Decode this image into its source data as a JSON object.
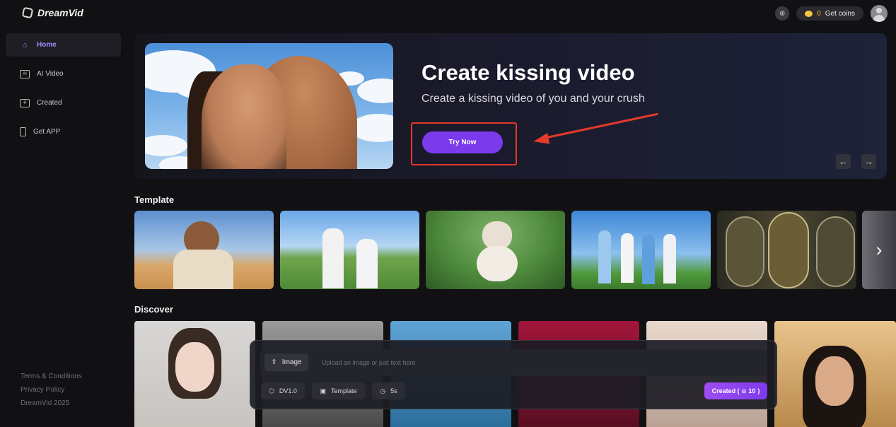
{
  "app": {
    "name": "DreamVid"
  },
  "header": {
    "coins": "0",
    "get_coins_label": "Get coins"
  },
  "sidebar": {
    "items": [
      {
        "label": "Home",
        "icon": "home-icon"
      },
      {
        "label": "AI Video",
        "icon": "ai-video-icon",
        "icon_text": "AI"
      },
      {
        "label": "Created",
        "icon": "created-icon"
      },
      {
        "label": "Get APP",
        "icon": "phone-icon"
      }
    ],
    "footer": {
      "terms": "Terms & Conditions",
      "privacy": "Privacy Policy",
      "copyright": "DreamVid 2025"
    }
  },
  "banner": {
    "title": "Create kissing video",
    "subtitle": "Create a kissing video of you and your crush",
    "cta": "Try Now",
    "prev_icon": "arrow-left-icon",
    "next_icon": "arrow-right-icon"
  },
  "sections": {
    "template_title": "Template",
    "discover_title": "Discover"
  },
  "prompt": {
    "image_label": "Image",
    "placeholder": "Upload an image or just text here",
    "model_label": "DV1.0",
    "template_label": "Template",
    "duration_label": "5s",
    "create_label": "Created (",
    "create_cost": "10",
    "create_close": ")"
  },
  "colors": {
    "accent": "#7c3aed",
    "annotation_red": "#e5392a",
    "coin": "#f4c542"
  }
}
